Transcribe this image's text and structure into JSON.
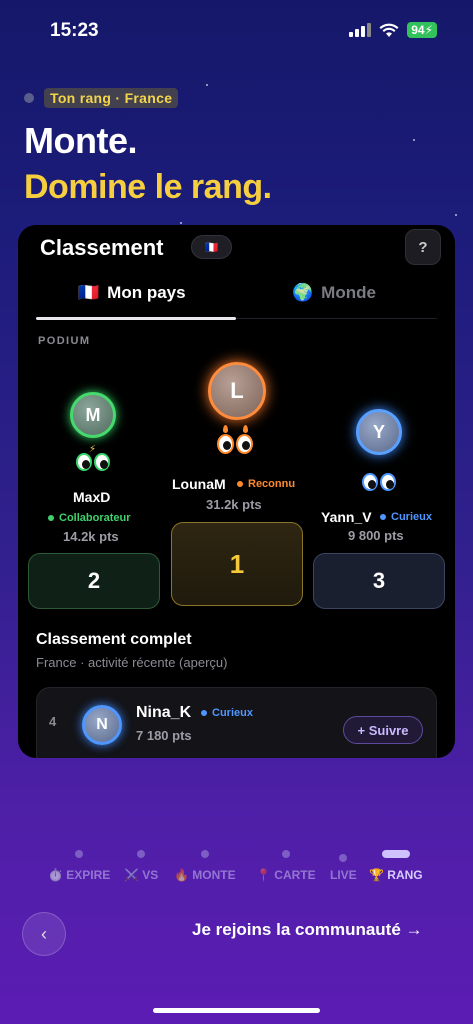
{
  "status_bar": {
    "time": "15:23",
    "battery": "94"
  },
  "hero": {
    "rank_label": "Ton rang · France",
    "line1": "Monte.",
    "line2": "Domine le rang."
  },
  "card": {
    "title": "Classement",
    "flag": "🇫🇷",
    "help": "?",
    "tabs": [
      {
        "flag": "🇫🇷",
        "label": "Mon pays"
      },
      {
        "flag": "🌍",
        "label": "Monde"
      }
    ],
    "podium_label": "PODIUM",
    "podium": {
      "first": {
        "initial": "L",
        "name": "LounaM",
        "badge": "Reconnu",
        "points": "31.2k pts",
        "place": "1"
      },
      "second": {
        "initial": "M",
        "name": "MaxD",
        "badge": "Collaborateur",
        "points": "14.2k pts",
        "place": "2"
      },
      "third": {
        "initial": "Y",
        "name": "Yann_V",
        "badge": "Curieux",
        "points": "9 800 pts",
        "place": "3"
      }
    },
    "full_title": "Classement complet",
    "full_subtitle": "France · activité récente (aperçu)",
    "rows": [
      {
        "rank": "4",
        "initial": "N",
        "name": "Nina_K",
        "badge": "Curieux",
        "points": "7 180 pts",
        "action": "+ Suivre"
      }
    ]
  },
  "nav": {
    "items": [
      {
        "icon": "⏱️",
        "label": "EXPIRE"
      },
      {
        "icon": "⚔️",
        "label": "VS"
      },
      {
        "icon": "🔥",
        "label": "MONTE"
      },
      {
        "icon": "📍",
        "label": "CARTE"
      },
      {
        "icon": "",
        "label": "LIVE"
      },
      {
        "icon": "🏆",
        "label": "RANG"
      }
    ]
  },
  "footer": {
    "back": "‹",
    "cta": "Je rejoins la communauté →"
  }
}
